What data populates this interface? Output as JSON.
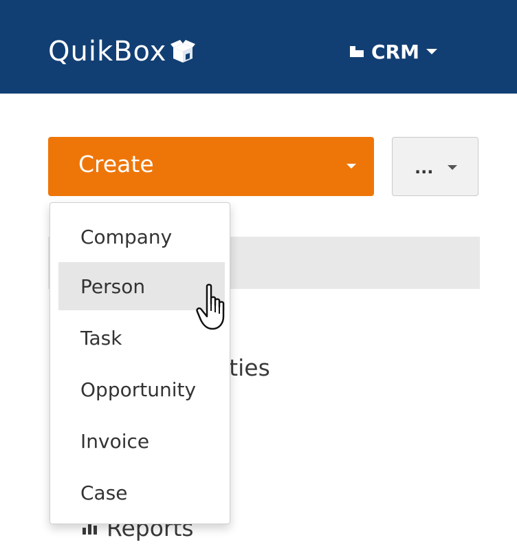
{
  "app": {
    "logo_text": "QuikBox",
    "module_label": "CRM"
  },
  "toolbar": {
    "create_label": "Create",
    "more_label": "..."
  },
  "create_menu": {
    "items": [
      {
        "label": "Company"
      },
      {
        "label": "Person"
      },
      {
        "label": "Task"
      },
      {
        "label": "Opportunity"
      },
      {
        "label": "Invoice"
      },
      {
        "label": "Case"
      }
    ],
    "hovered": "Person"
  },
  "background": {
    "activities_fragment": "ities",
    "reports_label": "Reports"
  },
  "colors": {
    "topbar": "#123f73",
    "create_button": "#ee7609",
    "hover_row": "#e6e6e6"
  },
  "icons": {
    "logo": "box-icon",
    "module": "building-icon",
    "reports": "bar-chart-icon",
    "cursor": "hand-pointer-icon"
  }
}
